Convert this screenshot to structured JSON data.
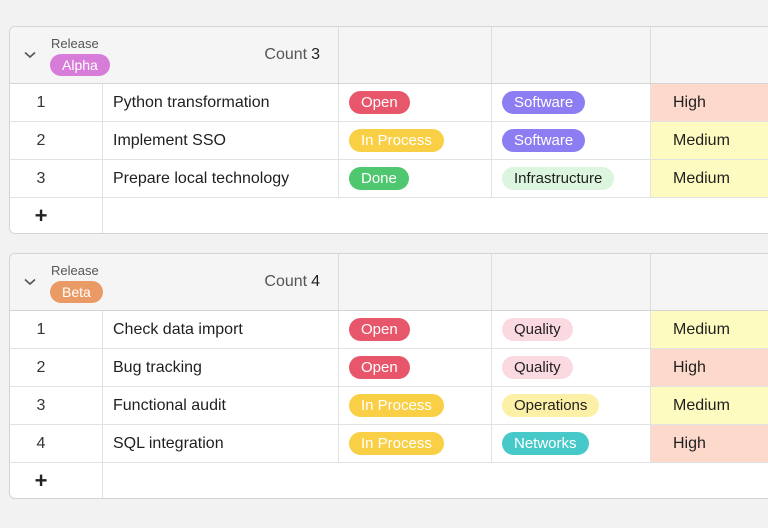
{
  "colors": {
    "status": {
      "Open": {
        "bg": "#e8566b",
        "fg": "#ffffff"
      },
      "In Process": {
        "bg": "#f9cf45",
        "fg": "#ffffff"
      },
      "Done": {
        "bg": "#4fc76f",
        "fg": "#ffffff"
      }
    },
    "category": {
      "Software": {
        "bg": "#8c7df2",
        "fg": "#ffffff"
      },
      "Infrastructure": {
        "bg": "#dbf5df",
        "fg": "#1f1f1f"
      },
      "Quality": {
        "bg": "#fbd9e1",
        "fg": "#1f1f1f"
      },
      "Operations": {
        "bg": "#fbf0a6",
        "fg": "#1f1f1f"
      },
      "Networks": {
        "bg": "#46c9c8",
        "fg": "#ffffff"
      }
    },
    "priority": {
      "High": "#fcd9cb",
      "Medium": "#fdfbc0"
    },
    "release": {
      "Alpha": "#d77cd8",
      "Beta": "#ea9a64"
    }
  },
  "groups": [
    {
      "field_label": "Release",
      "release": "Alpha",
      "count_label": "Count",
      "count": "3",
      "add_label": "+",
      "rows": [
        {
          "num": "1",
          "title": "Python transformation",
          "status": "Open",
          "category": "Software",
          "priority": "High"
        },
        {
          "num": "2",
          "title": "Implement SSO",
          "status": "In Process",
          "category": "Software",
          "priority": "Medium"
        },
        {
          "num": "3",
          "title": "Prepare local technology",
          "status": "Done",
          "category": "Infrastructure",
          "priority": "Medium"
        }
      ]
    },
    {
      "field_label": "Release",
      "release": "Beta",
      "count_label": "Count",
      "count": "4",
      "add_label": "+",
      "rows": [
        {
          "num": "1",
          "title": "Check data import",
          "status": "Open",
          "category": "Quality",
          "priority": "Medium"
        },
        {
          "num": "2",
          "title": "Bug tracking",
          "status": "Open",
          "category": "Quality",
          "priority": "High"
        },
        {
          "num": "3",
          "title": "Functional audit",
          "status": "In Process",
          "category": "Operations",
          "priority": "Medium"
        },
        {
          "num": "4",
          "title": "SQL integration",
          "status": "In Process",
          "category": "Networks",
          "priority": "High"
        }
      ]
    }
  ]
}
